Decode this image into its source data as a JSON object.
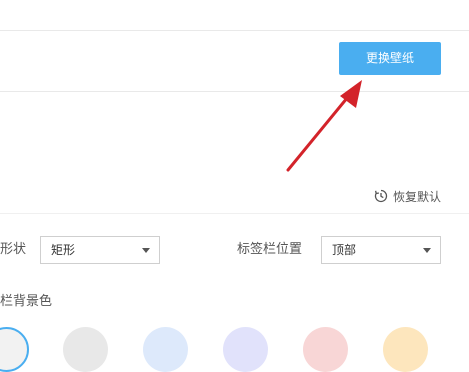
{
  "header": {
    "wallpaper_button_label": "更换壁纸"
  },
  "toolbar": {
    "restore_default_label": "恢复默认"
  },
  "settings": {
    "shape_label": "形状",
    "shape_value": "矩形",
    "position_label": "标签栏位置",
    "position_value": "顶部",
    "bg_color_label": "栏背景色"
  },
  "colors": {
    "button_accent": "#4aaef0",
    "annotation_arrow": "#d3232a",
    "swatches": [
      "#f2f2f2",
      "#e8e8e8",
      "#dde9fb",
      "#e1e2fb",
      "#f8d6d6",
      "#fde6bd"
    ]
  }
}
